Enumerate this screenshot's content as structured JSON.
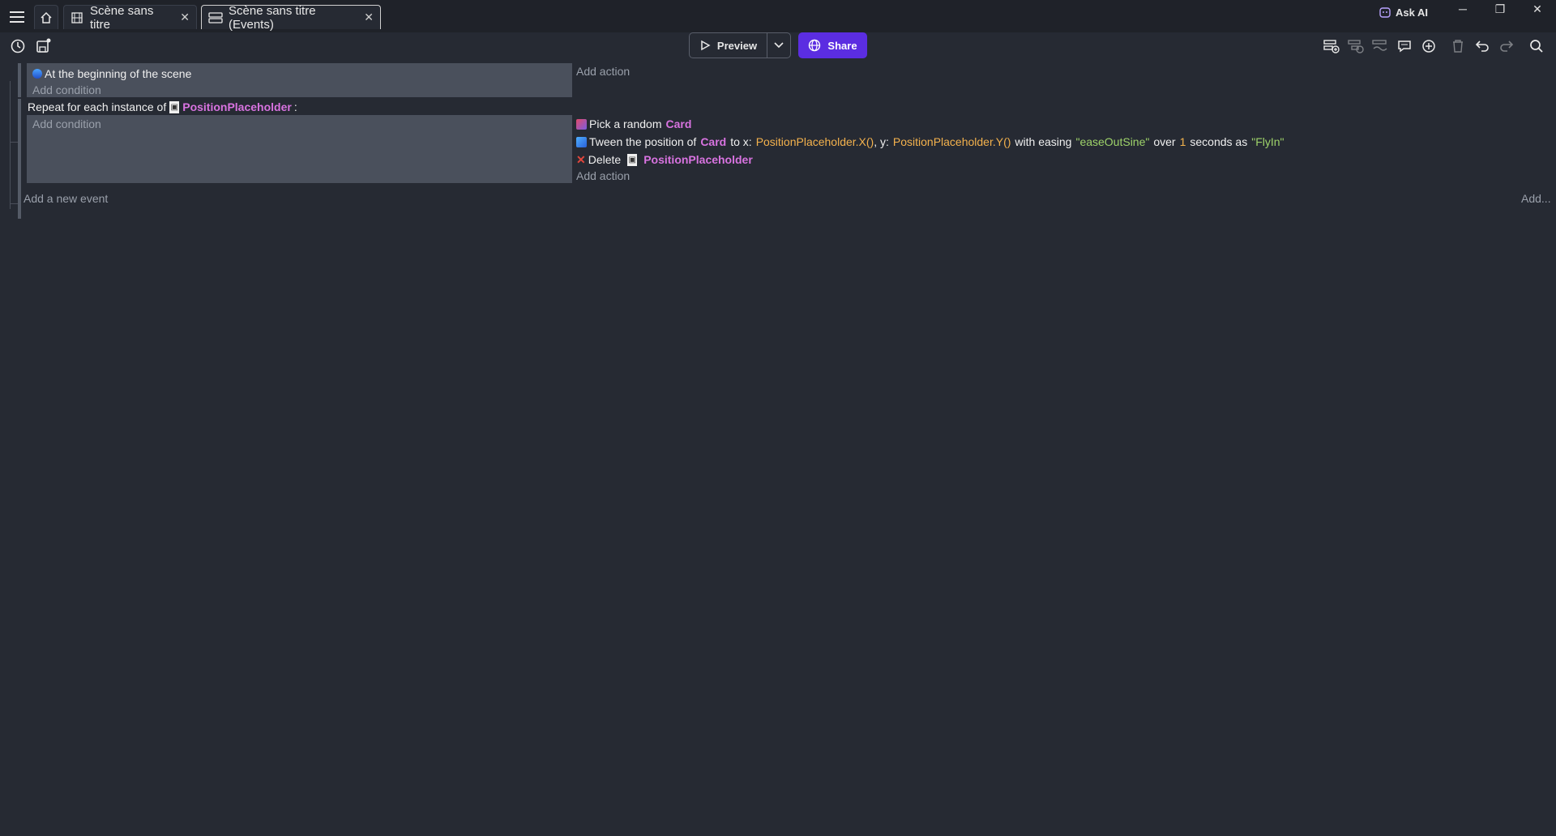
{
  "tabs": [
    {
      "label": "Scène sans titre"
    },
    {
      "label": "Scène sans titre (Events)"
    }
  ],
  "ask_ai_label": "Ask AI",
  "toolbar": {
    "preview_label": "Preview",
    "share_label": "Share"
  },
  "events": {
    "event1": {
      "condition": "At the beginning of the scene",
      "add_condition": "Add condition",
      "add_action": "Add action"
    },
    "event2": {
      "repeat_prefix": "Repeat for each instance of",
      "repeat_object": "PositionPlaceholder",
      "repeat_suffix": ":",
      "add_condition": "Add condition",
      "actions": {
        "a1_text": "Pick a random",
        "a1_obj": "Card",
        "a2_text1": "Tween the position of",
        "a2_obj": "Card",
        "a2_text2": "to x:",
        "a2_x": "PositionPlaceholder.X()",
        "a2_text3": ", y:",
        "a2_y": "PositionPlaceholder.Y()",
        "a2_text4": "with easing",
        "a2_easing": "\"easeOutSine\"",
        "a2_text5": "over",
        "a2_duration": "1",
        "a2_text6": "seconds as",
        "a2_name": "\"FlyIn\"",
        "a3_text": "Delete",
        "a3_obj": "PositionPlaceholder"
      },
      "add_action": "Add action"
    },
    "add_new_event": "Add a new event",
    "add_more": "Add..."
  }
}
